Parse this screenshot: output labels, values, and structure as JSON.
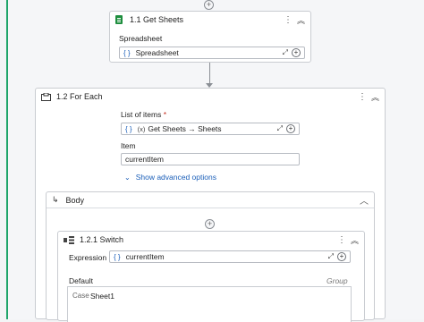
{
  "get_sheets": {
    "title": "1.1 Get Sheets",
    "spreadsheet_label": "Spreadsheet",
    "spreadsheet_value": "Spreadsheet"
  },
  "for_each": {
    "title": "1.2 For Each",
    "list_label": "List of items",
    "required_mark": "*",
    "list_value": "Get Sheets → Sheets",
    "item_label": "Item",
    "item_value": "currentItem",
    "advanced_link": "Show advanced options"
  },
  "body": {
    "title": "Body"
  },
  "switch": {
    "title": "1.2.1 Switch",
    "expression_label": "Expression",
    "expression_value": "currentItem",
    "default_label": "Default",
    "group_label": "Group",
    "case_label": "Case",
    "case_value": "Sheet1"
  },
  "colors": {
    "accent": "#1fa56a",
    "link": "#1b5fb9",
    "sheets_icon": "#1e8e3e"
  },
  "icons": [
    "add-icon",
    "sheets-icon",
    "kebab-menu-icon",
    "collapse-icon",
    "variable-icon",
    "expand-icon",
    "foreach-icon",
    "body-arrow-icon",
    "switch-icon",
    "chevron-down-icon"
  ]
}
